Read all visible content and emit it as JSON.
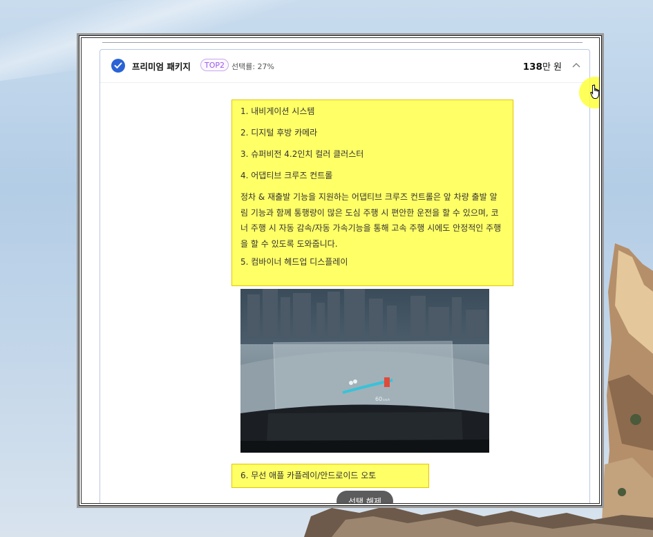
{
  "package": {
    "title": "프리미엄 패키지",
    "badge": "TOP2",
    "select_rate": "선택률: 27%",
    "price_number": "138",
    "price_unit": "만 원"
  },
  "features": [
    "1. 내비게이션 시스템",
    "2. 디지털 후방 카메라",
    "3. 슈퍼비전 4.2인치 컬러 클러스터",
    "4. 어댑티브 크루즈 컨트롤"
  ],
  "feature4_description": "정차 & 재출발 기능을 지원하는 어댑티브 크루즈 컨트롤은 앞 차량 출발 알림 기능과 함께 통행량이 많은 도심 주행 시 편안한 운전을 할 수 있으며, 코너 주행 시 자동 감속/자동 가속기능을 통해 고속 주행 시에도 안정적인 주행을 할 수 있도록 도와줍니다.",
  "feature5": "5. 컴바이너 헤드업 디스플레이",
  "hud_speed": "60",
  "hud_speed_unit": "km/h",
  "feature6": "6. 무선 애플 카플레이/안드로이드 오토",
  "deselect_label": "선택 해제",
  "icons": {
    "check": "check-icon",
    "chevron": "chevron-up-icon",
    "cursor": "hand-cursor-icon"
  },
  "colors": {
    "accent_blue": "#2a63d6",
    "highlight_yellow": "#ffff66",
    "badge_purple": "#9b59e6",
    "button_gray": "#5c5c5c"
  }
}
